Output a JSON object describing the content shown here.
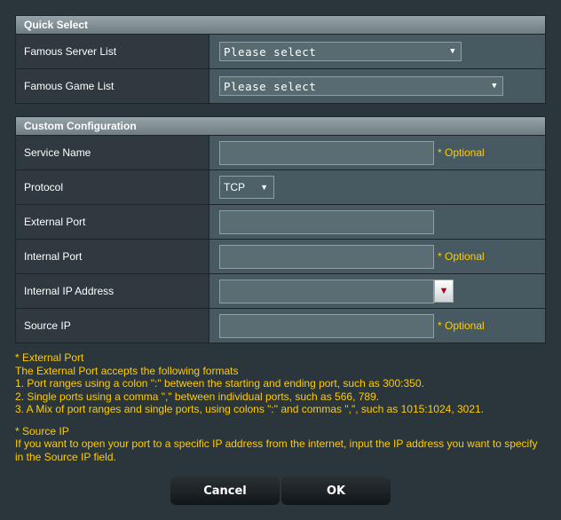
{
  "quick_select": {
    "title": "Quick Select",
    "rows": [
      {
        "label": "Famous Server List",
        "value": "Please select"
      },
      {
        "label": "Famous Game List",
        "value": "Please select"
      }
    ]
  },
  "custom": {
    "title": "Custom Configuration",
    "service_name": {
      "label": "Service Name",
      "value": "",
      "hint": "* Optional"
    },
    "protocol": {
      "label": "Protocol",
      "value": "TCP"
    },
    "external_port": {
      "label": "External Port",
      "value": ""
    },
    "internal_port": {
      "label": "Internal Port",
      "value": "",
      "hint": "* Optional"
    },
    "internal_ip": {
      "label": "Internal IP Address",
      "value": ""
    },
    "source_ip": {
      "label": "Source IP",
      "value": "",
      "hint": "* Optional"
    }
  },
  "notes": {
    "external_title": "* External Port",
    "external_lines": [
      "The External Port accepts the following formats",
      "1. Port ranges using a colon \":\" between the starting and ending port, such as 300:350.",
      "2. Single ports using a comma \",\" between individual ports, such as 566, 789.",
      "3. A Mix of port ranges and single ports, using colons \":\" and commas \",\", such as 1015:1024, 3021."
    ],
    "source_title": "* Source IP",
    "source_lines": [
      "If you want to open your port to a specific IP address from the internet, input the IP address you want to specify",
      "in the Source IP field."
    ]
  },
  "buttons": {
    "cancel": "Cancel",
    "ok": "OK"
  },
  "colors": {
    "hint": "#ffcc00",
    "background": "#2b363c",
    "dropdown_arrow": "#b00010"
  }
}
